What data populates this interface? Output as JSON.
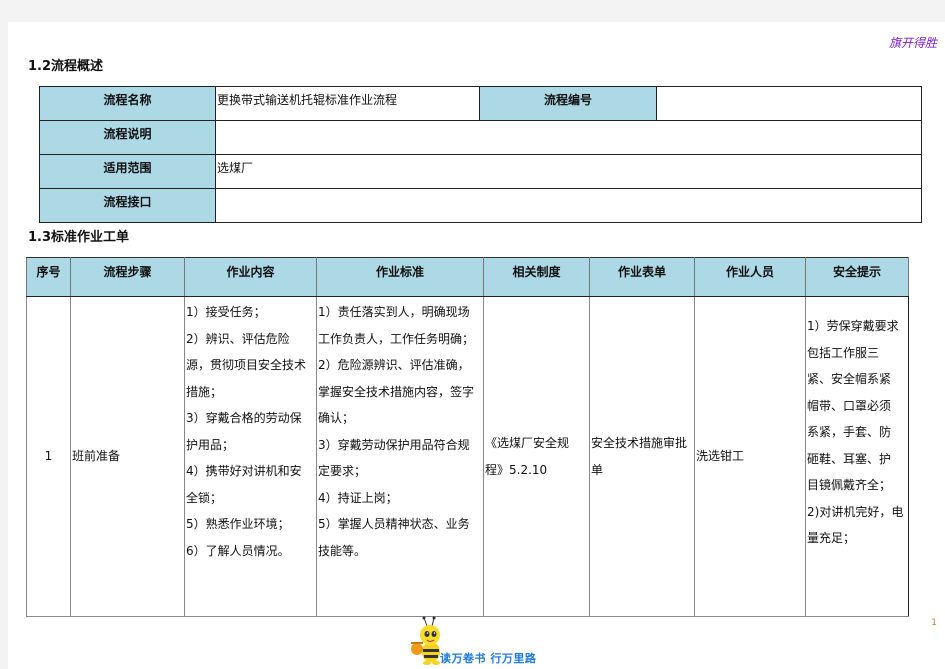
{
  "header": {
    "slogan": "旗开得胜"
  },
  "overview": {
    "section_title": "1.2流程概述",
    "rows": [
      {
        "label": "流程名称",
        "value": "更换带式输送机托辊标准作业流程",
        "label2": "流程编号",
        "value2": ""
      },
      {
        "label": "流程说明",
        "value": ""
      },
      {
        "label": "适用范围",
        "value": "选煤厂"
      },
      {
        "label": "流程接口",
        "value": ""
      }
    ]
  },
  "sop": {
    "section_title": "1.3标准作业工单",
    "headers": [
      "序号",
      "流程步骤",
      "作业内容",
      "作业标准",
      "相关制度",
      "作业表单",
      "作业人员",
      "安全提示"
    ],
    "rows": [
      {
        "seq": "1",
        "step": "班前准备",
        "content_lines": [
          "1）接受任务；",
          "2）辨识、评估危险",
          "源，贯彻项目安全技术",
          "措施；",
          "3）穿戴合格的劳动保",
          "护用品；",
          "4）携带好对讲机和安",
          "全锁；",
          "5）熟悉作业环境；",
          "6）了解人员情况。"
        ],
        "standard_lines": [
          "1）责任落实到人，明确现场",
          "工作负责人，工作任务明确；",
          "2）危险源辨识、评估准确，",
          "掌握安全技术措施内容，签字",
          "确认；",
          "3）穿戴劳动保护用品符合规",
          "定要求；",
          "4）持证上岗；",
          "5）掌握人员精神状态、业务",
          "技能等。"
        ],
        "regulation_lines": [
          "《选煤厂安全规",
          "程》5.2.10"
        ],
        "form_lines": [
          "安全技术措施审批",
          "单"
        ],
        "personnel": "洗选钳工",
        "safety_lines": [
          "1）劳保穿戴要求",
          "包括工作服三",
          "紧、安全帽系紧",
          "帽带、口罩必须",
          "系紧，手套、防",
          "砸鞋、耳塞、护",
          "目镜佩戴齐全；",
          "2)对讲机完好，电",
          "量充足；"
        ]
      }
    ]
  },
  "footer": {
    "page_number": "1",
    "motto": "读万卷书  行万里路",
    "mascot_icon": "bee-mascot-icon"
  },
  "colors": {
    "header_fill": "#add8e6",
    "slogan": "#7b1fd6",
    "motto": "#1e7be0"
  }
}
